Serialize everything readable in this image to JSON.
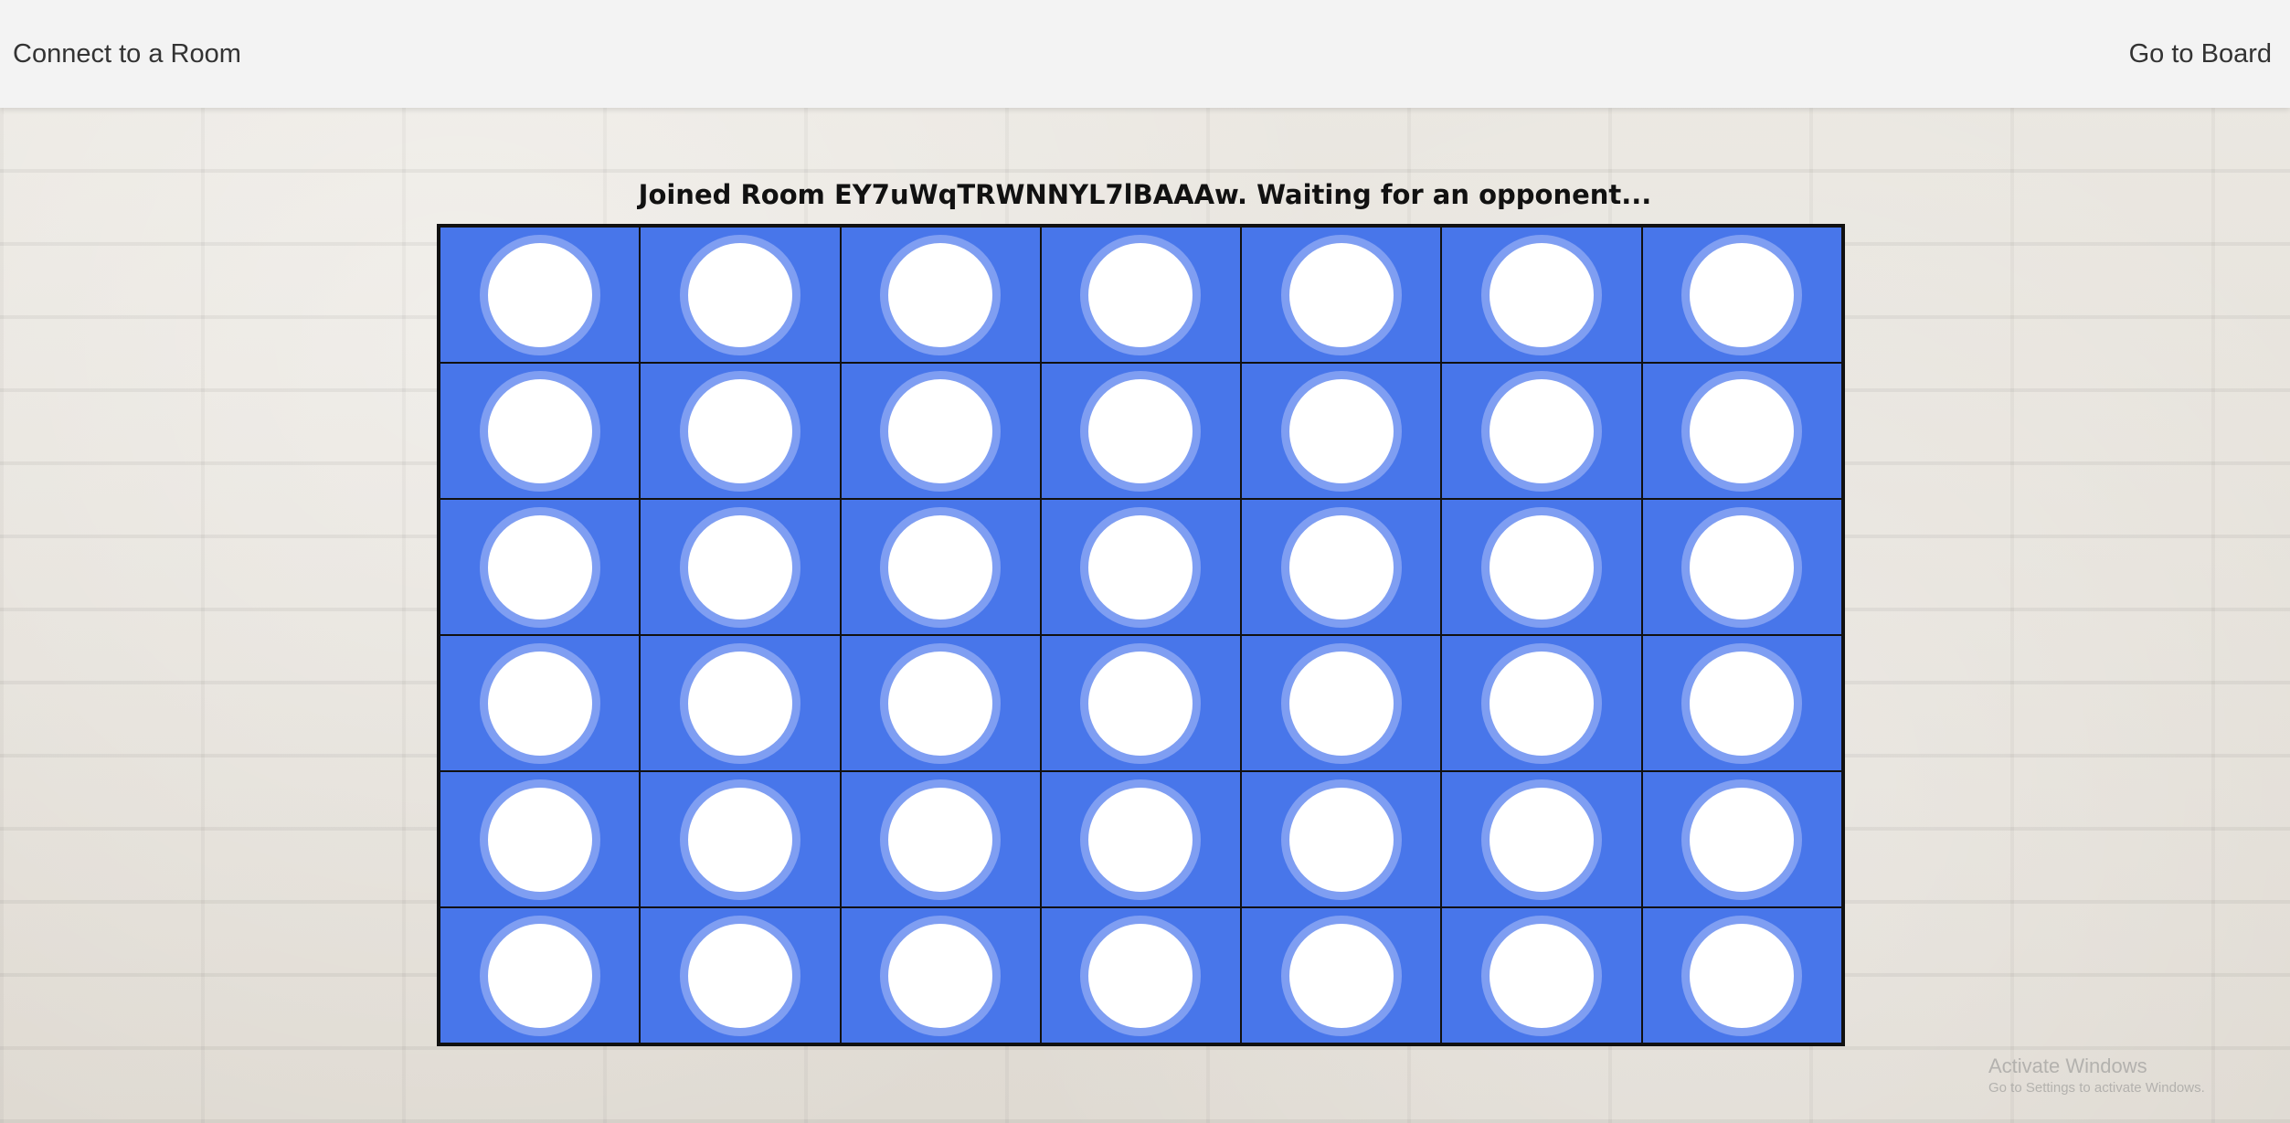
{
  "navbar": {
    "left_link": "Connect to a Room",
    "right_link": "Go to Board"
  },
  "status": {
    "message": "Joined Room EY7uWqTRWNNYL7lBAAAw. Waiting for an opponent..."
  },
  "board": {
    "columns": 7,
    "rows": 6,
    "cells": [
      [
        "empty",
        "empty",
        "empty",
        "empty",
        "empty",
        "empty",
        "empty"
      ],
      [
        "empty",
        "empty",
        "empty",
        "empty",
        "empty",
        "empty",
        "empty"
      ],
      [
        "empty",
        "empty",
        "empty",
        "empty",
        "empty",
        "empty",
        "empty"
      ],
      [
        "empty",
        "empty",
        "empty",
        "empty",
        "empty",
        "empty",
        "empty"
      ],
      [
        "empty",
        "empty",
        "empty",
        "empty",
        "empty",
        "empty",
        "empty"
      ],
      [
        "empty",
        "empty",
        "empty",
        "empty",
        "empty",
        "empty",
        "empty"
      ]
    ]
  },
  "watermark": {
    "title": "Activate Windows",
    "subtitle": "Go to Settings to activate Windows."
  },
  "colors": {
    "board": "#4876ea",
    "slot_ring": "#7f9ef2",
    "slot_empty": "#ffffff",
    "grid_lines": "#111111",
    "navbar_bg": "#f3f3f3"
  }
}
